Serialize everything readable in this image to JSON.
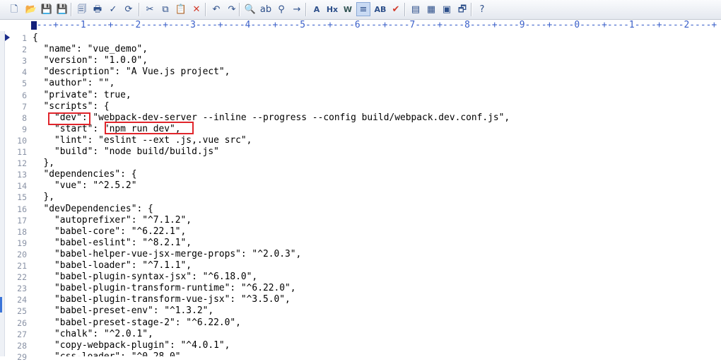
{
  "toolbar": {
    "buttons": [
      {
        "name": "new-file-icon",
        "glyph": "🗋"
      },
      {
        "name": "open-file-icon",
        "glyph": "📂"
      },
      {
        "name": "save-icon",
        "glyph": "💾"
      },
      {
        "name": "save-all-icon",
        "glyph": "💾"
      },
      {
        "name": "print-preview-icon",
        "glyph": "🗐"
      },
      {
        "name": "print-icon",
        "glyph": "🖶"
      },
      {
        "name": "spell-check-icon",
        "glyph": "✓"
      },
      {
        "name": "reload-icon",
        "glyph": "⟳"
      },
      {
        "name": "cut-icon",
        "glyph": "✂"
      },
      {
        "name": "copy-icon",
        "glyph": "⧉"
      },
      {
        "name": "paste-icon",
        "glyph": "📋"
      },
      {
        "name": "delete-icon",
        "glyph": "✕"
      },
      {
        "name": "undo-icon",
        "glyph": "↶"
      },
      {
        "name": "redo-icon",
        "glyph": "↷"
      },
      {
        "name": "find-icon",
        "glyph": "🔍"
      },
      {
        "name": "replace-icon",
        "glyph": "ab"
      },
      {
        "name": "find-in-files-icon",
        "glyph": "⚲"
      },
      {
        "name": "goto-line-icon",
        "glyph": "→"
      },
      {
        "name": "font-icon",
        "text": "A"
      },
      {
        "name": "hex-icon",
        "text": "Hx"
      },
      {
        "name": "word-wrap-icon",
        "text": "W"
      },
      {
        "name": "line-numbers-icon",
        "glyph": "≡",
        "active": true
      },
      {
        "name": "column-mode-icon",
        "text": "AB"
      },
      {
        "name": "check-icon",
        "glyph": "✔"
      },
      {
        "name": "view-icon-1",
        "glyph": "▤"
      },
      {
        "name": "view-icon-2",
        "glyph": "▦"
      },
      {
        "name": "view-icon-3",
        "glyph": "▣"
      },
      {
        "name": "view-icon-4",
        "glyph": "🗗"
      },
      {
        "name": "help-icon",
        "glyph": "?"
      }
    ]
  },
  "ruler": {
    "text": "----+----1----+----2----+----3----+----4----+----5----+----6----+----7----+----8----+----9----+----0----+----1----+----2----+"
  },
  "editor": {
    "lines": [
      {
        "num": "1",
        "text": "{"
      },
      {
        "num": "2",
        "text": "  \"name\": \"vue_demo\","
      },
      {
        "num": "3",
        "text": "  \"version\": \"1.0.0\","
      },
      {
        "num": "4",
        "text": "  \"description\": \"A Vue.js project\","
      },
      {
        "num": "5",
        "text": "  \"author\": \"\","
      },
      {
        "num": "6",
        "text": "  \"private\": true,"
      },
      {
        "num": "7",
        "text": "  \"scripts\": {"
      },
      {
        "num": "8",
        "text": "    \"dev\": \"webpack-dev-server --inline --progress --config build/webpack.dev.conf.js\","
      },
      {
        "num": "9",
        "text": "    \"start\": \"npm run dev\","
      },
      {
        "num": "10",
        "text": "    \"lint\": \"eslint --ext .js,.vue src\","
      },
      {
        "num": "11",
        "text": "    \"build\": \"node build/build.js\""
      },
      {
        "num": "12",
        "text": "  },"
      },
      {
        "num": "13",
        "text": "  \"dependencies\": {"
      },
      {
        "num": "14",
        "text": "    \"vue\": \"^2.5.2\""
      },
      {
        "num": "15",
        "text": "  },"
      },
      {
        "num": "16",
        "text": "  \"devDependencies\": {"
      },
      {
        "num": "17",
        "text": "    \"autoprefixer\": \"^7.1.2\","
      },
      {
        "num": "18",
        "text": "    \"babel-core\": \"^6.22.1\","
      },
      {
        "num": "19",
        "text": "    \"babel-eslint\": \"^8.2.1\","
      },
      {
        "num": "20",
        "text": "    \"babel-helper-vue-jsx-merge-props\": \"^2.0.3\","
      },
      {
        "num": "21",
        "text": "    \"babel-loader\": \"^7.1.1\","
      },
      {
        "num": "22",
        "text": "    \"babel-plugin-syntax-jsx\": \"^6.18.0\","
      },
      {
        "num": "23",
        "text": "    \"babel-plugin-transform-runtime\": \"^6.22.0\","
      },
      {
        "num": "24",
        "text": "    \"babel-plugin-transform-vue-jsx\": \"^3.5.0\","
      },
      {
        "num": "25",
        "text": "    \"babel-preset-env\": \"^1.3.2\","
      },
      {
        "num": "26",
        "text": "    \"babel-preset-stage-2\": \"^6.22.0\","
      },
      {
        "num": "27",
        "text": "    \"chalk\": \"^2.0.1\","
      },
      {
        "num": "28",
        "text": "    \"copy-webpack-plugin\": \"^4.0.1\","
      },
      {
        "num": "29",
        "text": "    \"css-loader\": \"^0.28.0\","
      }
    ]
  }
}
